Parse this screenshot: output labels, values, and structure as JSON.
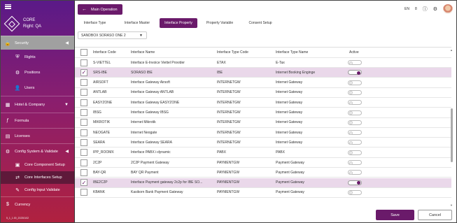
{
  "sidebar": {
    "brand_title": "CORE",
    "brand_right": "Right: QA",
    "security": "Security",
    "rights": "Rights",
    "positions": "Positions",
    "users": "Users",
    "hotel_company": "Hotel & Company",
    "formula": "Formula",
    "licenses": "Licenses",
    "config_system": "Config System & Validate",
    "core_component_setup": "Core Component Setup",
    "core_interfaces_setup": "Core Interfaces Setup",
    "config_input_validate": "Config Input Validate",
    "currency": "Currency",
    "footer_version": "5_1_1.00_20230102"
  },
  "topbar": {
    "main_operation": "Main Operation",
    "lang": "EN",
    "notif_count": "8"
  },
  "tabs": {
    "interface_type": "Interface Type",
    "interface_master": "Interface Master",
    "interface_property": "Interface Property",
    "property_variable": "Property Variable",
    "consent_setup": "Consent Setup"
  },
  "hotel_select": {
    "value": "SANDBOX SORASO ONE 2"
  },
  "table": {
    "headers": {
      "code": "Interface Code",
      "name": "Interface Name",
      "type_code": "Interface Type Code",
      "type_name": "Interface Type Name",
      "active": "Active"
    },
    "rows": [
      {
        "code": "S-VIETTEL",
        "name": "Interface E-Invoice Viettel Provider",
        "type_code": "ETAX",
        "type_name": "E-Tax",
        "checked": false,
        "active": false
      },
      {
        "code": "SRS-IBE",
        "name": "SORASO IBE",
        "type_code": "IBE",
        "type_name": "Internet Booking Enginge",
        "checked": true,
        "active": true
      },
      {
        "code": "AIRSOFT",
        "name": "Interface Gateway Airsoft",
        "type_code": "INTERNETGW",
        "type_name": "Internet Gateway",
        "checked": false,
        "active": false
      },
      {
        "code": "ANTLAB",
        "name": "Interface Gateway ANTLAB",
        "type_code": "INTERNETGW",
        "type_name": "Internet Gateway",
        "checked": false,
        "active": false
      },
      {
        "code": "EASYZONE",
        "name": "Interface Gateway EASYZONE",
        "type_code": "INTERNETGW",
        "type_name": "Internet Gateway",
        "checked": false,
        "active": false
      },
      {
        "code": "IBSG",
        "name": "Interface Gateway IBSG",
        "type_code": "INTERNETGW",
        "type_name": "Internet Gateway",
        "checked": false,
        "active": false
      },
      {
        "code": "MIKROTIK",
        "name": "Internet Mikrotik",
        "type_code": "INTERNETGW",
        "type_name": "Internet Gateway",
        "checked": false,
        "active": false
      },
      {
        "code": "NEOGATE",
        "name": "Internet Neogate",
        "type_code": "INTERNETGW",
        "type_name": "Internet Gateway",
        "checked": false,
        "active": false
      },
      {
        "code": "SEARA",
        "name": "Interface Gateway SEARA",
        "type_code": "INTERNETGW",
        "type_name": "Internet Gateway",
        "checked": false,
        "active": false
      },
      {
        "code": "IPP_ROOMX",
        "name": "Interface PABX i-dynamic",
        "type_code": "PABX",
        "type_name": "PABX",
        "checked": false,
        "active": false
      },
      {
        "code": "2C2P",
        "name": "2C2P Payment Gateway",
        "type_code": "PAYMENTGW",
        "type_name": "Payment Gateway",
        "checked": false,
        "active": false
      },
      {
        "code": "BAY-QR",
        "name": "BAY QR Payment",
        "type_code": "PAYMENTGW",
        "type_name": "Payment Gateway",
        "checked": false,
        "active": false
      },
      {
        "code": "IBE2C2P",
        "name": "Interface Payment gateway 2c2p for IBE SO...",
        "type_code": "PAYMENTGW",
        "type_name": "Payment Gateway",
        "checked": true,
        "active": true
      },
      {
        "code": "KBANK",
        "name": "Kasikorn Bank Payment Gateway",
        "type_code": "PAYMENTGW",
        "type_name": "Payment Gateway",
        "checked": false,
        "active": false
      }
    ]
  },
  "footer": {
    "save": "Save",
    "cancel": "Cancel"
  },
  "colors": {
    "accent": "#6a1a6a",
    "sidebar_top": "#5a1a88",
    "sidebar_bottom": "#b0213f",
    "selected_row": "#ead8ea"
  }
}
